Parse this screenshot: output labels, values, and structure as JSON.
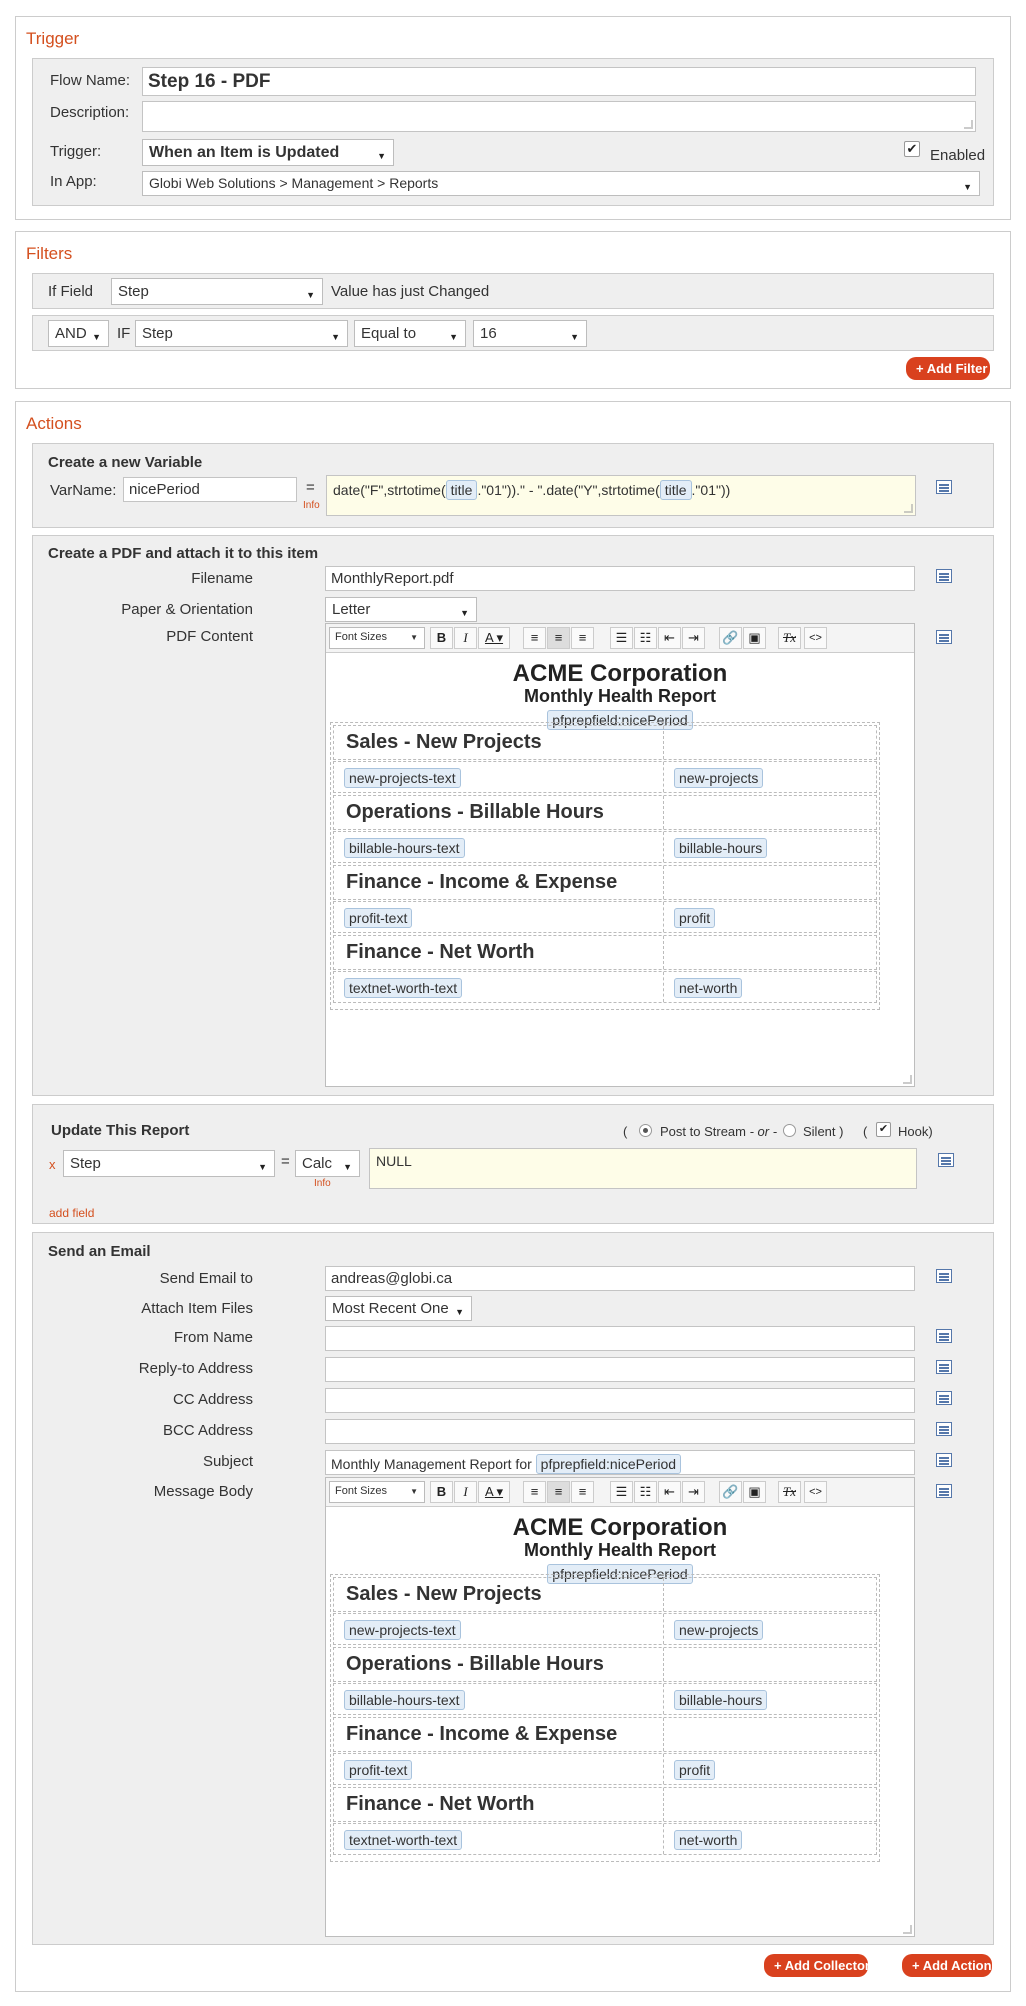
{
  "trigger": {
    "title": "Trigger",
    "flow_name_label": "Flow Name:",
    "flow_name_value": "Step 16 - PDF",
    "description_label": "Description:",
    "trigger_label": "Trigger:",
    "trigger_value": "When an Item is Updated",
    "enabled_label": "Enabled",
    "enabled_checked": true,
    "in_app_label": "In App:",
    "in_app_value": "Globi Web Solutions > Management > Reports"
  },
  "filters": {
    "title": "Filters",
    "if_field_label": "If Field",
    "if_field_value": "Step",
    "changed_label": "Value has just Changed",
    "logic_value": "AND",
    "if_label": "IF",
    "cond_field_value": "Step",
    "operator_value": "Equal to",
    "cond_value": "16",
    "add_filter_label": "+ Add Filter"
  },
  "actions": {
    "title": "Actions",
    "variable": {
      "header": "Create a new Variable",
      "varname_label": "VarName:",
      "varname_value": "nicePeriod",
      "equals": "=",
      "info": "Info",
      "expr_a": "date(\"F\",strtotime(",
      "expr_tag1": "title",
      "expr_b": ".\"01\")).\" - \".date(\"Y\",strtotime(",
      "expr_tag2": "title",
      "expr_c": ".\"01\"))"
    },
    "pdf": {
      "header": "Create a PDF and attach it to this item",
      "filename_label": "Filename",
      "filename_value": "MonthlyReport.pdf",
      "paper_label": "Paper & Orientation",
      "paper_value": "Letter",
      "content_label": "PDF Content"
    },
    "update": {
      "header": "Update This Report",
      "paren_open": "(",
      "post_label": "Post to Stream",
      "or_label": "- or -",
      "silent_label": "Silent )",
      "paren_open2": "(",
      "hook_label": "Hook)",
      "remove": "x",
      "field_value": "Step",
      "equals": "=",
      "calc_value": "Calc",
      "info": "Info",
      "value": "NULL",
      "add_field": "add field"
    },
    "email": {
      "header": "Send an Email",
      "send_to_label": "Send Email to",
      "send_to_value": "andreas@globi.ca",
      "attach_label": "Attach Item Files",
      "attach_value": "Most Recent One",
      "from_label": "From Name",
      "reply_label": "Reply-to Address",
      "cc_label": "CC Address",
      "bcc_label": "BCC Address",
      "subject_label": "Subject",
      "subject_prefix": "Monthly Management Report for",
      "subject_tag": "pfprepfield:nicePeriod",
      "body_label": "Message Body"
    },
    "add_collector": "+ Add Collector",
    "add_action": "+ Add Action"
  },
  "editor": {
    "font_sizes": "Font Sizes",
    "doc_title": "ACME Corporation",
    "doc_subtitle": "Monthly Health Report",
    "doc_tag": "pfprepfield:nicePeriod",
    "rows": [
      {
        "heading": "Sales - New Projects",
        "left_tag": "new-projects-text",
        "right_tag": "new-projects"
      },
      {
        "heading": "Operations - Billable Hours",
        "left_tag": "billable-hours-text",
        "right_tag": "billable-hours"
      },
      {
        "heading": "Finance - Income & Expense",
        "left_tag": "profit-text",
        "right_tag": "profit"
      },
      {
        "heading": "Finance - Net Worth",
        "left_tag": "textnet-worth-text",
        "right_tag": "net-worth"
      }
    ]
  }
}
